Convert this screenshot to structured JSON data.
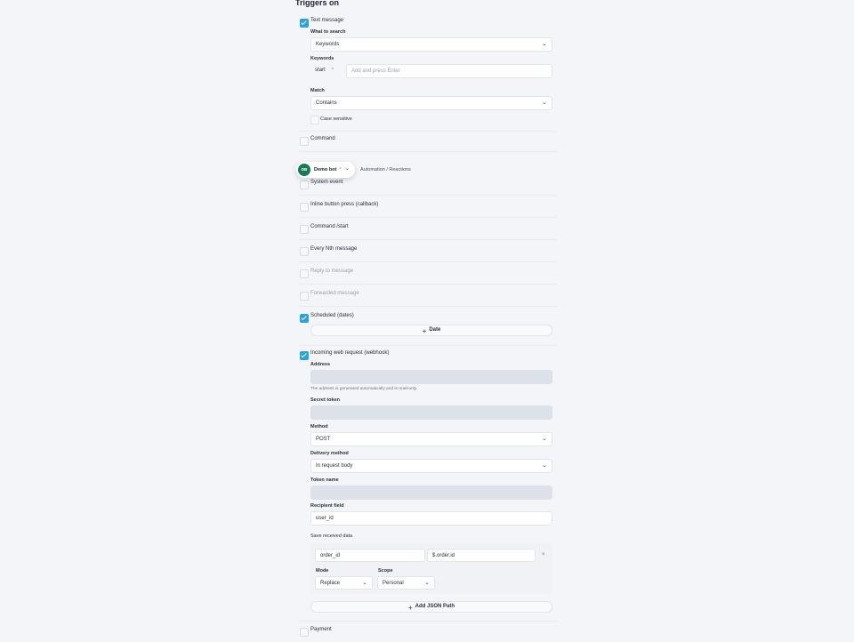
{
  "title": "Triggers on",
  "botbar": {
    "avatar": "DB",
    "name": "Demo bot",
    "breadcrumb": "Automation / Reactions"
  },
  "text_message": {
    "label": "Text message",
    "checked": true,
    "what_to_search_label": "What to search",
    "what_to_search_value": "Keywords",
    "keywords_label": "Keywords",
    "keyword_tag": "start",
    "keywords_placeholder": "Add and press Enter",
    "match_label": "Match",
    "match_value": "Contains",
    "case_sensitive_label": "Case sensitive"
  },
  "triggers": {
    "command": "Command",
    "system_event": "System event",
    "inline_button": "Inline button press (callback)",
    "command_start": "Command /start",
    "every_nth": "Every Nth message",
    "reply_to": "Reply to message",
    "forwarded": "Forwarded message",
    "scheduled": "Scheduled (dates)",
    "webhook": "Incoming web request (webhook)",
    "payment": "Payment"
  },
  "scheduled": {
    "add_date_label": "Date"
  },
  "webhook": {
    "address_label": "Address",
    "address_hint": "The address is generated automatically and is read-only.",
    "secret_token_label": "Secret token",
    "method_label": "Method",
    "method_value": "POST",
    "delivery_label": "Delivery method",
    "delivery_value": "In request body",
    "token_name_label": "Token name",
    "recipient_label": "Recipient field",
    "recipient_value": "user_id",
    "save_label": "Save received data",
    "save_row": {
      "name": "order_id",
      "path": "$.order.id"
    },
    "mode_label": "Mode",
    "mode_value": "Replace",
    "scope_label": "Scope",
    "scope_value": "Personal",
    "add_json_label": "Add JSON Path"
  },
  "icons": {
    "chevron": "chevron-down-icon",
    "check": "check-icon",
    "plus": "plus-icon",
    "close": "close-icon"
  },
  "colors": {
    "accent": "#2aa3d7",
    "bot_avatar": "#1a7a55",
    "background": "#f3f5f9"
  }
}
